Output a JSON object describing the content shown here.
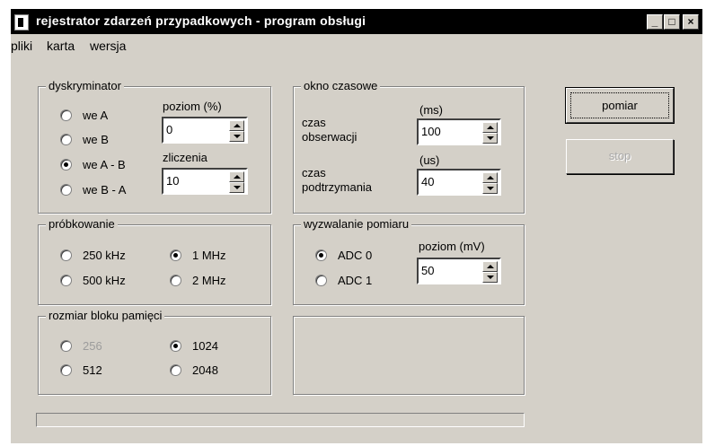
{
  "window": {
    "title": "rejestrator zdarzeń przypadkowych  -  program obsługi"
  },
  "menu": [
    "pliki",
    "karta",
    "wersja"
  ],
  "dyskryminator": {
    "legend": "dyskryminator",
    "options": [
      "we  A",
      "we  B",
      "we A - B",
      "we B - A"
    ],
    "selected": "we A - B",
    "poziom_label": "poziom (%)",
    "poziom_value": "0",
    "zliczenia_label": "zliczenia",
    "zliczenia_value": "10"
  },
  "okno": {
    "legend": "okno czasowe",
    "obs_label": "czas\nobserwacji",
    "obs_unit": "(ms)",
    "obs_value": "100",
    "podtrz_label": "czas\npodtrzymania",
    "podtrz_unit": "(us)",
    "podtrz_value": "40"
  },
  "probkowanie": {
    "legend": "próbkowanie",
    "options": [
      "250 kHz",
      "1 MHz",
      "500 kHz",
      "2 MHz"
    ],
    "selected": "1 MHz"
  },
  "wyzwalanie": {
    "legend": "wyzwalanie pomiaru",
    "options": [
      "ADC 0",
      "ADC 1"
    ],
    "selected": "ADC 0",
    "poziom_label": "poziom (mV)",
    "poziom_value": "50"
  },
  "blok": {
    "legend": "rozmiar bloku pamięci",
    "options": [
      "256",
      "1024",
      "512",
      "2048"
    ],
    "selected": "1024",
    "disabled": "256"
  },
  "buttons": {
    "pomiar": "pomiar",
    "stop": "stop"
  },
  "titlebar_buttons": [
    "_",
    "□",
    "×"
  ],
  "progress": 0
}
